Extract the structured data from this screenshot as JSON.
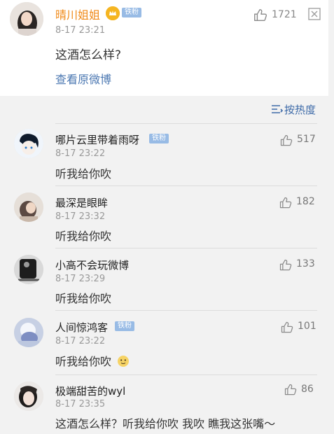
{
  "top_comment": {
    "author": "晴川姐姐",
    "badge": "铁粉",
    "time": "8-17 23:21",
    "text": "这酒怎么样?",
    "view_original": "查看原微博",
    "likes": "1721"
  },
  "sort": {
    "label": "按热度"
  },
  "replies": [
    {
      "author": "哪片云里带着雨呀",
      "badge": "铁粉",
      "time": "8-17 23:22",
      "text": "听我给你吹",
      "likes": "517"
    },
    {
      "author": "最深是眼眸",
      "badge": "",
      "time": "8-17 23:32",
      "text": "听我给你吹",
      "likes": "182"
    },
    {
      "author": "小高不会玩微博",
      "badge": "",
      "time": "8-17 23:29",
      "text": "听我给你吹",
      "likes": "133"
    },
    {
      "author": "人间惊鸿客",
      "badge": "铁粉",
      "time": "8-17 23:22",
      "text": "听我给你吹",
      "likes": "101"
    },
    {
      "author": "极端甜苦的wyl",
      "badge": "",
      "time": "8-17 23:35",
      "text": "这酒怎么样？听我给你吹 我吹 瞧我这张嘴～",
      "likes": "86"
    }
  ],
  "colors": {
    "author_highlight": "#f08a18",
    "link": "#4c78b2",
    "badge_bg": "#98bbe5",
    "page_bg": "#f2f2f2",
    "card_bg": "#ffffff"
  },
  "icons": {
    "like": "thumb-up-icon",
    "close": "close-icon",
    "sort": "sort-icon",
    "vip": "vip-crown-icon",
    "emoji": "doge-emoji-icon"
  }
}
